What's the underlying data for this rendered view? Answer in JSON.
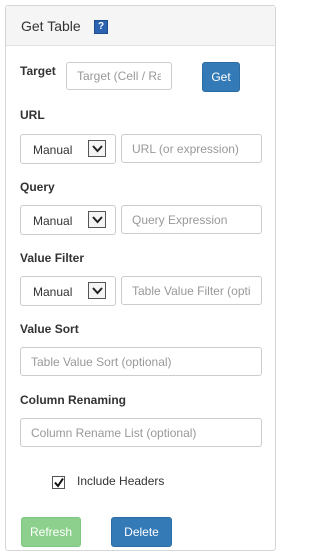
{
  "panel": {
    "title": "Get Table",
    "help_glyph": "?"
  },
  "target": {
    "label": "Target",
    "placeholder": "Target (Cell / Range)",
    "button_label": "Get"
  },
  "url": {
    "label": "URL",
    "mode": "Manual",
    "placeholder": "URL (or expression)"
  },
  "query": {
    "label": "Query",
    "mode": "Manual",
    "placeholder": "Query Expression"
  },
  "value_filter": {
    "label": "Value Filter",
    "mode": "Manual",
    "placeholder": "Table Value Filter (optional)"
  },
  "value_sort": {
    "label": "Value Sort",
    "placeholder": "Table Value Sort (optional)"
  },
  "column_renaming": {
    "label": "Column Renaming",
    "placeholder": "Column Rename List (optional)"
  },
  "include_headers": {
    "label": "Include Headers",
    "checked": true
  },
  "actions": {
    "refresh_label": "Refresh",
    "delete_label": "Delete"
  },
  "colors": {
    "primary": "#337ab7",
    "success_disabled": "#8dd08d",
    "help_icon": "#2c63b0"
  }
}
